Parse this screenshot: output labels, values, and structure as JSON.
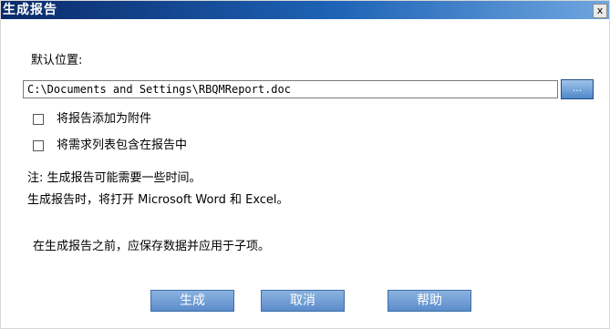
{
  "dialog": {
    "title": "生成报告",
    "close_label": "x"
  },
  "location": {
    "label": "默认位置:",
    "path_value": "C:\\Documents and Settings\\RBQMReport.doc",
    "browse_label": "..."
  },
  "options": [
    {
      "label": "将报告添加为附件",
      "checked": false
    },
    {
      "label": "将需求列表包含在报告中",
      "checked": false
    }
  ],
  "notes": {
    "line1": "注: 生成报告可能需要一些时间。",
    "line2": "生成报告时，将打开 Microsoft Word 和 Excel。",
    "line3": "在生成报告之前，应保存数据并应用于子项。"
  },
  "buttons": {
    "generate": "生成",
    "cancel": "取消",
    "help": "帮助"
  }
}
